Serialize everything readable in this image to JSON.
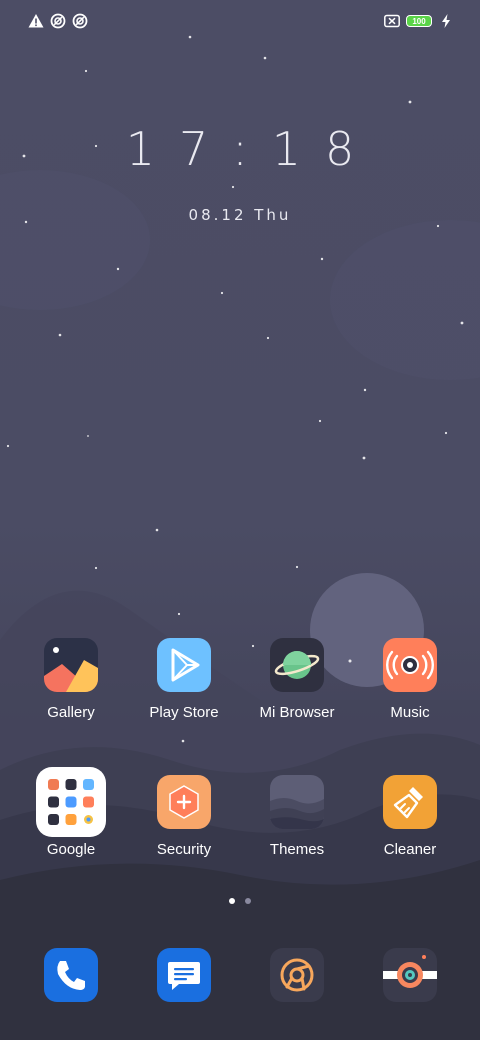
{
  "status_bar": {
    "left_icons": [
      "warning-icon",
      "sync-icon",
      "data-saver-icon"
    ],
    "battery_level": "100",
    "right_icons": [
      "sim-off-icon",
      "battery-icon",
      "charging-icon"
    ]
  },
  "lockclock": {
    "time": "17:18",
    "date": "08.12 Thu"
  },
  "home": {
    "row1": [
      {
        "label": "Gallery",
        "icon": "gallery-icon"
      },
      {
        "label": "Play Store",
        "icon": "play-store-icon"
      },
      {
        "label": "Mi Browser",
        "icon": "browser-planet-icon"
      },
      {
        "label": "Music",
        "icon": "music-speaker-icon"
      }
    ],
    "row2": [
      {
        "label": "Google",
        "icon": "google-folder-icon"
      },
      {
        "label": "Security",
        "icon": "security-shield-icon"
      },
      {
        "label": "Themes",
        "icon": "themes-icon"
      },
      {
        "label": "Cleaner",
        "icon": "cleaner-brush-icon"
      }
    ]
  },
  "page_indicator": {
    "pages": 2,
    "current": 1
  },
  "dock": [
    {
      "name": "phone",
      "icon": "phone-icon"
    },
    {
      "name": "messages",
      "icon": "messages-icon"
    },
    {
      "name": "chrome",
      "icon": "chrome-icon"
    },
    {
      "name": "camera",
      "icon": "camera-icon"
    }
  ],
  "colors": {
    "background": "#4a4b63",
    "accent_play": "#6ec1ff",
    "accent_music": "#ff7f5a",
    "accent_security": "#f8a66a",
    "accent_cleaner": "#f2a236",
    "dock_blue": "#1a6fe0"
  }
}
